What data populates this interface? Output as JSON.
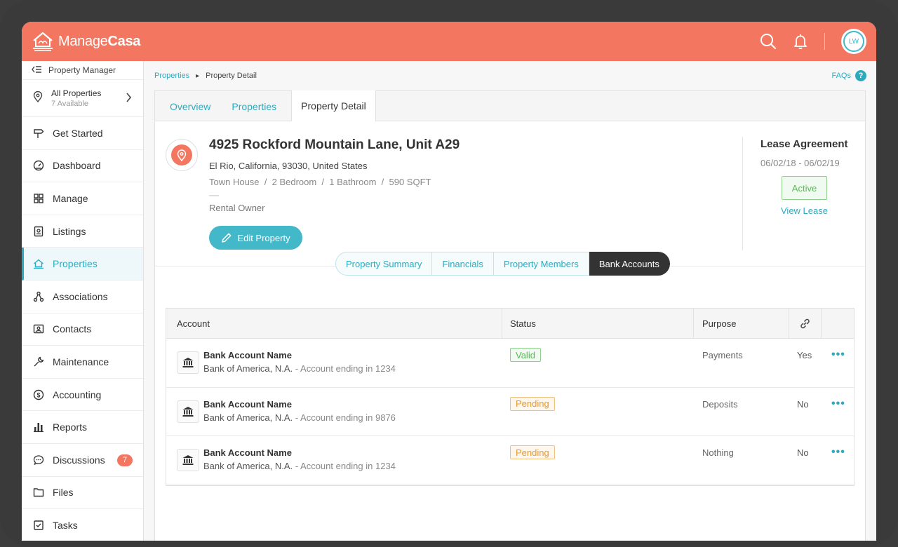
{
  "app": {
    "logo_light": "Manage",
    "logo_bold": "Casa",
    "avatar_initials": "LW"
  },
  "colors": {
    "brand": "#f37660",
    "accent": "#2eaabe",
    "valid": "#5cb85c",
    "pending": "#e59a30"
  },
  "header": {
    "icons": [
      "search-icon",
      "bell-icon"
    ]
  },
  "sidebar": {
    "top_label": "Property Manager",
    "properties_selector": {
      "title": "All Properties",
      "subtitle": "7 Available"
    },
    "items": [
      {
        "label": "Get Started",
        "icon": "signpost-icon"
      },
      {
        "label": "Dashboard",
        "icon": "gauge-icon"
      },
      {
        "label": "Manage",
        "icon": "grid-icon"
      },
      {
        "label": "Listings",
        "icon": "listings-icon"
      },
      {
        "label": "Properties",
        "icon": "house-icon",
        "active": true
      },
      {
        "label": "Associations",
        "icon": "network-icon"
      },
      {
        "label": "Contacts",
        "icon": "contact-card-icon"
      },
      {
        "label": "Maintenance",
        "icon": "wrench-icon"
      },
      {
        "label": "Accounting",
        "icon": "dollar-icon"
      },
      {
        "label": "Reports",
        "icon": "bar-chart-icon"
      },
      {
        "label": "Discussions",
        "icon": "chat-icon",
        "badge": "7"
      },
      {
        "label": "Files",
        "icon": "folder-icon"
      },
      {
        "label": "Tasks",
        "icon": "checkbox-icon"
      }
    ]
  },
  "breadcrumb": {
    "root": "Properties",
    "current": "Property Detail"
  },
  "faqs_label": "FAQs",
  "tabs": [
    "Overview",
    "Properties",
    "Property Detail"
  ],
  "property": {
    "title": "4925 Rockford Mountain Lane, Unit A29",
    "address": "El Rio, California, 93030, United States",
    "meta": "Town House  /  2 Bedroom  /  1 Bathroom  /  590 SQFT",
    "owner": "Rental Owner",
    "edit_label": "Edit Property"
  },
  "lease": {
    "title": "Lease Agreement",
    "dates": "06/02/18 - 06/02/19",
    "status": "Active",
    "link": "View Lease"
  },
  "sections": [
    "Property Summary",
    "Financials",
    "Property Members",
    "Bank Accounts"
  ],
  "table": {
    "headers": {
      "account": "Account",
      "status": "Status",
      "purpose": "Purpose"
    },
    "rows": [
      {
        "name": "Bank Account Name",
        "bank": "Bank of America, N.A.",
        "ending": " - Account ending in 1234",
        "status": "Valid",
        "status_type": "valid",
        "purpose": "Payments",
        "linked": "Yes"
      },
      {
        "name": "Bank Account Name",
        "bank": "Bank of America, N.A.",
        "ending": " - Account ending in 9876",
        "status": "Pending",
        "status_type": "pending",
        "purpose": "Deposits",
        "linked": "No"
      },
      {
        "name": "Bank Account Name",
        "bank": "Bank of America, N.A.",
        "ending": " - Account ending in 1234",
        "status": "Pending",
        "status_type": "pending",
        "purpose": "Nothing",
        "linked": "No"
      }
    ]
  }
}
